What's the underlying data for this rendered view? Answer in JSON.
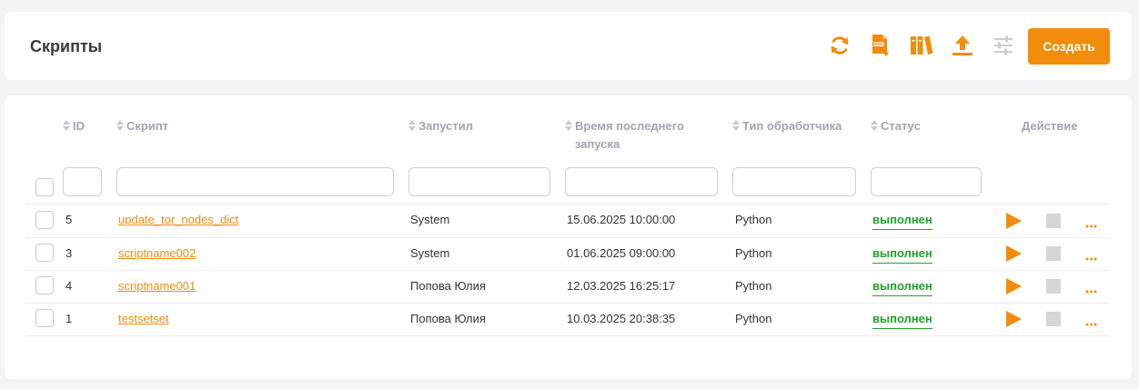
{
  "header": {
    "title": "Скрипты",
    "create_label": "Создать",
    "tools": [
      "refresh-icon",
      "pdf-export-icon",
      "library-icon",
      "upload-icon",
      "settings-sliders-icon"
    ]
  },
  "table": {
    "columns": {
      "id": "ID",
      "script": "Скрипт",
      "launched_by": "Запустил",
      "last_run_line1": "Время последнего",
      "last_run_line2": "запуска",
      "handler": "Тип обработчика",
      "status": "Статус",
      "action": "Действие"
    },
    "rows": [
      {
        "id": "5",
        "script": "update_tor_nodes_dict",
        "launched_by": "System",
        "last_run": "15.06.2025 10:00:00",
        "handler": "Python",
        "status": "выполнен"
      },
      {
        "id": "3",
        "script": "scriptname002",
        "launched_by": "System",
        "last_run": "01.06.2025 09:00:00",
        "handler": "Python",
        "status": "выполнен"
      },
      {
        "id": "4",
        "script": "scriptname001",
        "launched_by": "Попова Юлия",
        "last_run": "12.03.2025 16:25:17",
        "handler": "Python",
        "status": "выполнен"
      },
      {
        "id": "1",
        "script": "testsetset",
        "launched_by": "Попова Юлия",
        "last_run": "10.03.2025 20:38:35",
        "handler": "Python",
        "status": "выполнен"
      }
    ]
  },
  "colors": {
    "accent": "#f28c0d",
    "status_ok": "#1fa32a",
    "stop_gray": "#d3d5d9",
    "disabled_icon": "#c9ccd3"
  }
}
